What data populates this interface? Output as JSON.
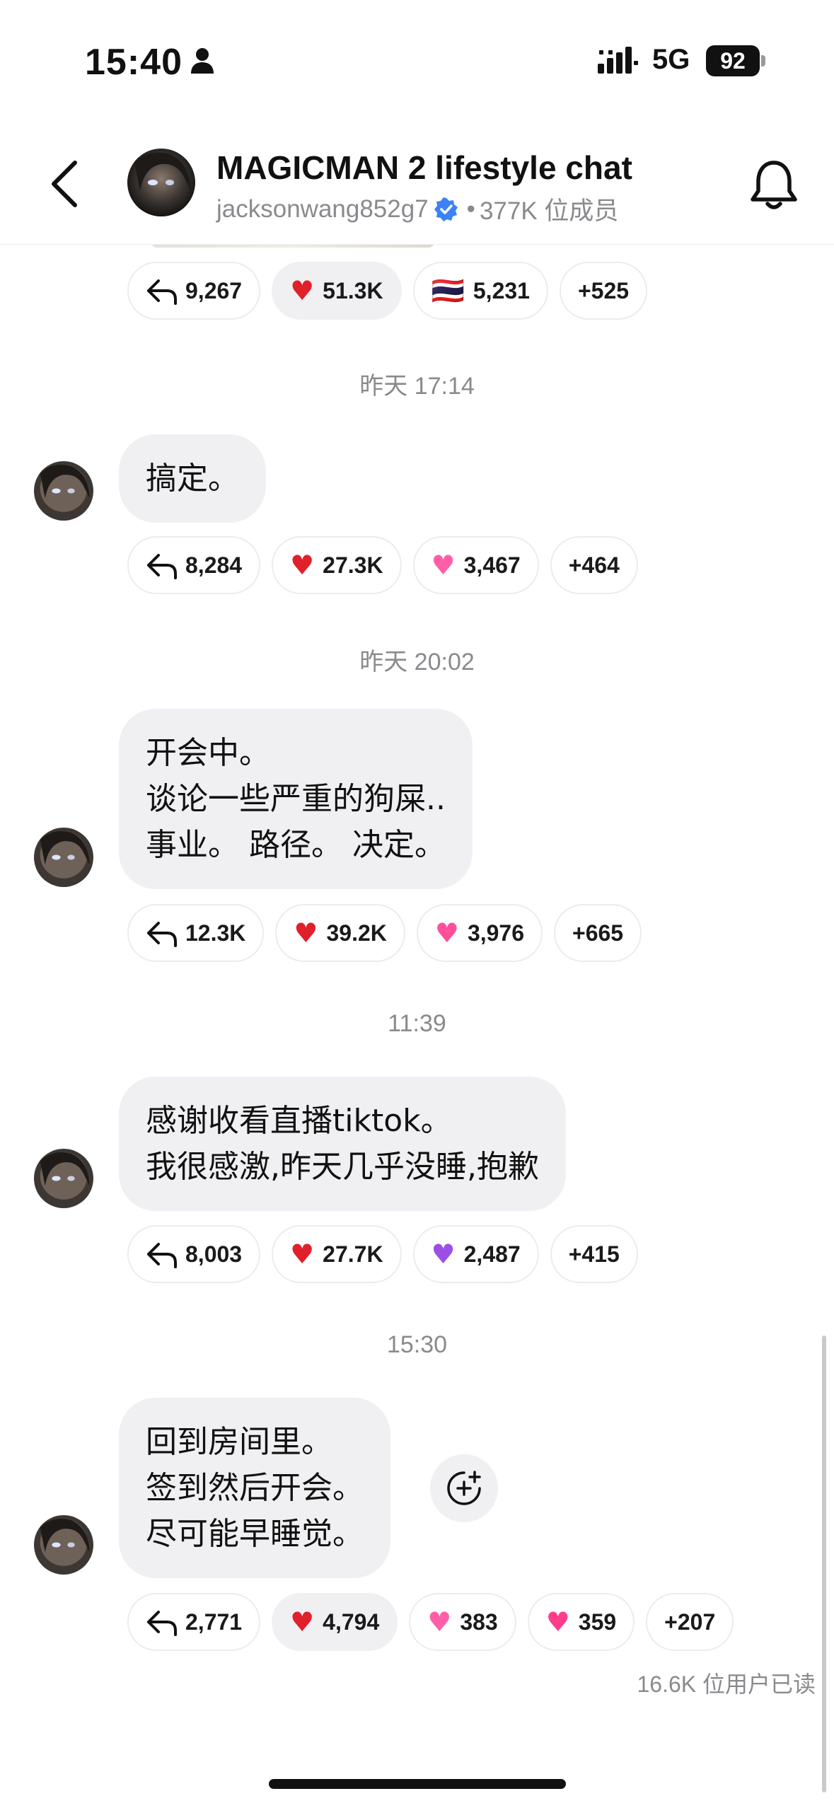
{
  "status_bar": {
    "time": "15:40",
    "network": "5G",
    "battery": "92"
  },
  "header": {
    "title": "MAGICMAN 2 lifestyle chat",
    "handle": "jacksonwang852g7",
    "separator": "•",
    "members": "377K 位成员",
    "verified": true
  },
  "messages": [
    {
      "timestamp": "",
      "text": [],
      "reactions": {
        "reply": "9,267",
        "heart": "51.3K",
        "third_emoji": "🇹🇭",
        "third": "5,231",
        "more": "+525"
      }
    },
    {
      "timestamp": "昨天 17:14",
      "text": [
        "搞定。"
      ],
      "reactions": {
        "reply": "8,284",
        "heart": "27.3K",
        "third_emoji": "💗",
        "third": "3,467",
        "more": "+464"
      }
    },
    {
      "timestamp": "昨天 20:02",
      "text": [
        "开会中。",
        "谈论一些严重的狗屎..",
        "事业。 路径。 决定。"
      ],
      "reactions": {
        "reply": "12.3K",
        "heart": "39.2K",
        "third_emoji": "💖",
        "third": "3,976",
        "more": "+665"
      }
    },
    {
      "timestamp": "11:39",
      "text": [
        "感谢收看直播tiktok。",
        "我很感激,昨天几乎没睡,抱歉"
      ],
      "reactions": {
        "reply": "8,003",
        "heart": "27.7K",
        "third_emoji": "💜",
        "third": "2,487",
        "more": "+415"
      }
    },
    {
      "timestamp": "15:30",
      "text": [
        "回到房间里。",
        "签到然后开会。",
        "尽可能早睡觉。"
      ],
      "reactions": {
        "reply": "2,771",
        "heart": "4,794",
        "third_emoji": "💗",
        "third": "383",
        "fourth_emoji": "💞",
        "fourth": "359",
        "more": "+207"
      }
    }
  ],
  "read_receipt": "16.6K 位用户已读",
  "icons": [
    "back-chevron-icon",
    "bell-icon",
    "reply-arrow-icon",
    "add-reaction-icon",
    "verified-badge-icon",
    "person-icon",
    "signal-icon"
  ],
  "colors": {
    "bubble": "#f0f0f2",
    "heart": "#e0202a",
    "verified": "#3b82f6",
    "muted_text": "#8a8a8e"
  }
}
